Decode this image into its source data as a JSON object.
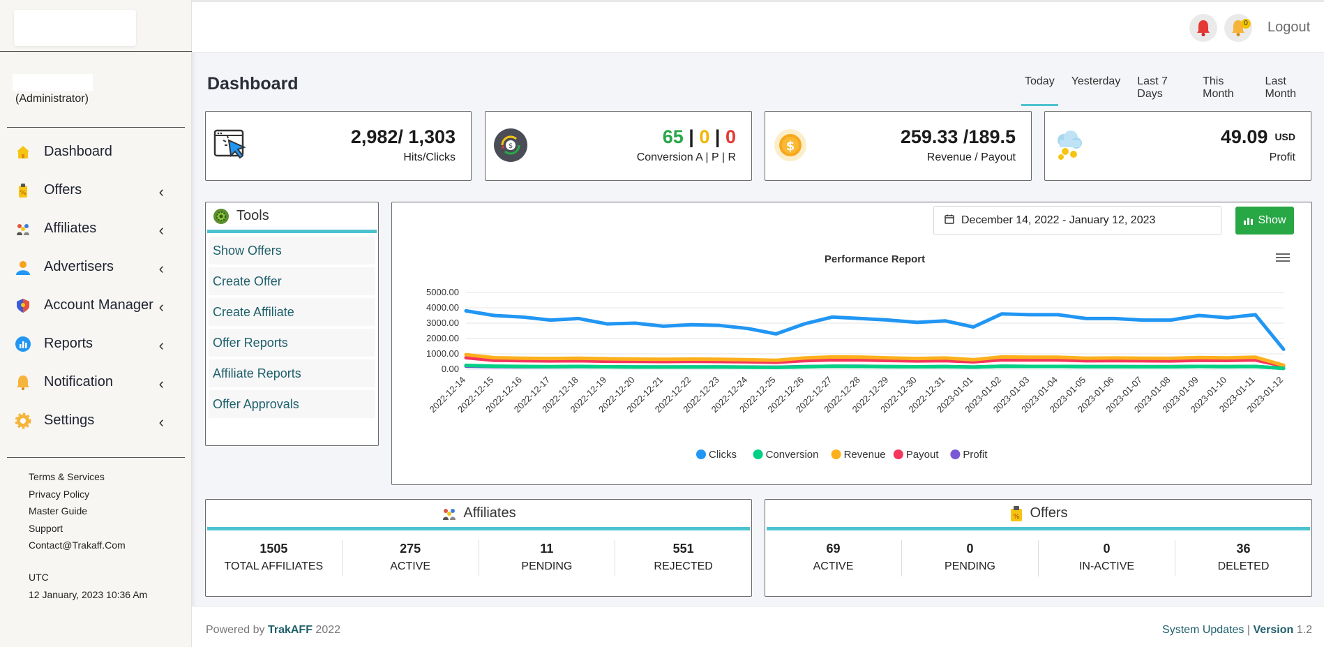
{
  "sidebar": {
    "role": "(Administrator)",
    "items": [
      {
        "label": "Dashboard",
        "icon": "home-icon"
      },
      {
        "label": "Offers",
        "icon": "offer-tag-icon"
      },
      {
        "label": "Affiliates",
        "icon": "affiliates-icon"
      },
      {
        "label": "Advertisers",
        "icon": "user-icon"
      },
      {
        "label": "Account Manager",
        "icon": "shield-icon"
      },
      {
        "label": "Reports",
        "icon": "reports-icon"
      },
      {
        "label": "Notification",
        "icon": "bell-icon"
      },
      {
        "label": "Settings",
        "icon": "gear-icon"
      }
    ],
    "links": [
      "Terms & Services",
      "Privacy Policy",
      "Master Guide",
      "Support",
      "Contact@Trakaff.Com"
    ],
    "timezone": "UTC",
    "datetime": "12 January, 2023 10:36 Am"
  },
  "header": {
    "notification_count": "0",
    "logout": "Logout"
  },
  "page": {
    "title": "Dashboard",
    "ranges": [
      "Today",
      "Yesterday",
      "Last 7 Days",
      "This Month",
      "Last Month"
    ],
    "active_range": "Today"
  },
  "stats": {
    "hits_value": "2,982/ 1,303",
    "hits_label": "Hits/Clicks",
    "conv_a": "65",
    "conv_p": "0",
    "conv_r": "0",
    "conv_sep": "|",
    "conv_label": "Conversion A | P | R",
    "revenue_value": "259.33 /189.5",
    "revenue_label": "Revenue / Payout",
    "profit_value": "49.09",
    "profit_currency": "USD",
    "profit_label": "Profit"
  },
  "tools": {
    "title": "Tools",
    "items": [
      "Show Offers",
      "Create Offer",
      "Create Affiliate",
      "Offer Reports",
      "Affiliate Reports",
      "Offer Approvals"
    ]
  },
  "chart_controls": {
    "date_range": "December 14, 2022 - January 12, 2023",
    "show_label": "Show"
  },
  "colors": {
    "accent": "#4dc3cf",
    "green": "#28a745",
    "clicks": "#2196f3",
    "conversion": "#00d084",
    "revenue": "#fdb01c",
    "payout": "#f5365c",
    "profit": "#7957d5"
  },
  "chart_data": {
    "type": "line",
    "title": "Performance Report",
    "ylim": [
      0,
      5000
    ],
    "yticks": [
      "0.00",
      "1000.00",
      "2000.00",
      "3000.00",
      "4000.00",
      "5000.00"
    ],
    "x": [
      "2022-12-14",
      "2022-12-15",
      "2022-12-16",
      "2022-12-17",
      "2022-12-18",
      "2022-12-19",
      "2022-12-20",
      "2022-12-21",
      "2022-12-22",
      "2022-12-23",
      "2022-12-24",
      "2022-12-25",
      "2022-12-26",
      "2022-12-27",
      "2022-12-28",
      "2022-12-29",
      "2022-12-30",
      "2022-12-31",
      "2023-01-01",
      "2023-01-02",
      "2023-01-03",
      "2023-01-04",
      "2023-01-05",
      "2023-01-06",
      "2023-01-07",
      "2023-01-08",
      "2023-01-09",
      "2023-01-10",
      "2023-01-11",
      "2023-01-12"
    ],
    "series": [
      {
        "name": "Clicks",
        "color": "#2196f3",
        "values": [
          3800,
          3500,
          3400,
          3200,
          3300,
          2950,
          3000,
          2800,
          2900,
          2850,
          2650,
          2300,
          2950,
          3400,
          3300,
          3200,
          3050,
          3150,
          2750,
          3600,
          3550,
          3550,
          3300,
          3300,
          3200,
          3200,
          3500,
          3350,
          3550,
          1300
        ]
      },
      {
        "name": "Conversion",
        "color": "#00d084",
        "values": [
          250,
          200,
          180,
          170,
          180,
          160,
          150,
          140,
          150,
          150,
          130,
          120,
          160,
          190,
          180,
          170,
          160,
          170,
          140,
          190,
          180,
          180,
          170,
          170,
          160,
          160,
          180,
          170,
          180,
          60
        ]
      },
      {
        "name": "Revenue",
        "color": "#fdb01c",
        "values": [
          950,
          750,
          720,
          700,
          720,
          680,
          660,
          650,
          660,
          650,
          620,
          580,
          730,
          800,
          790,
          740,
          700,
          730,
          620,
          800,
          780,
          780,
          720,
          730,
          720,
          710,
          760,
          740,
          780,
          260
        ]
      },
      {
        "name": "Payout",
        "color": "#f5365c",
        "values": [
          750,
          580,
          560,
          540,
          550,
          520,
          510,
          500,
          510,
          500,
          480,
          450,
          560,
          610,
          600,
          570,
          540,
          560,
          480,
          610,
          600,
          600,
          550,
          560,
          550,
          540,
          580,
          570,
          600,
          200
        ]
      },
      {
        "name": "Profit",
        "color": "#7957d5",
        "values": [
          200,
          170,
          160,
          160,
          170,
          160,
          150,
          150,
          150,
          150,
          140,
          130,
          170,
          190,
          190,
          170,
          160,
          170,
          140,
          190,
          180,
          180,
          170,
          170,
          170,
          170,
          180,
          170,
          180,
          60
        ]
      }
    ]
  },
  "affiliates_panel": {
    "title": "Affiliates",
    "stats": [
      {
        "value": "1505",
        "label": "TOTAL AFFILIATES"
      },
      {
        "value": "275",
        "label": "ACTIVE"
      },
      {
        "value": "11",
        "label": "PENDING"
      },
      {
        "value": "551",
        "label": "REJECTED"
      }
    ]
  },
  "offers_panel": {
    "title": "Offers",
    "stats": [
      {
        "value": "69",
        "label": "ACTIVE"
      },
      {
        "value": "0",
        "label": "PENDING"
      },
      {
        "value": "0",
        "label": "IN-ACTIVE"
      },
      {
        "value": "36",
        "label": "DELETED"
      }
    ]
  },
  "footer": {
    "powered_prefix": "Powered by",
    "brand": "TrakAFF",
    "year": "2022",
    "updates": "System Updates",
    "separator": "|",
    "version_label": "Version",
    "version_value": "1.2"
  }
}
